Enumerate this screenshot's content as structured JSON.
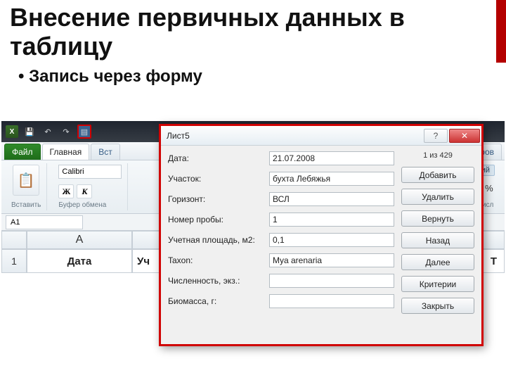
{
  "slide": {
    "title": "Внесение первичных данных в таблицу",
    "bullet": "Запись через форму"
  },
  "qat": {
    "app": "X",
    "save": "💾",
    "undo": "↶",
    "redo": "↷",
    "form": "▤"
  },
  "tabs": {
    "file": "Файл",
    "home": "Главная",
    "insert": "Вст",
    "review": "ензиров"
  },
  "ribbon": {
    "paste_label": "Вставить",
    "clipboard_group": "Буфер обмена",
    "font": "Calibri",
    "bold": "Ж",
    "italic": "К",
    "percent": "%",
    "number_group": "Числ",
    "cond_fmt": "ий"
  },
  "namebox": "A1",
  "grid": {
    "colA": "A",
    "colTlast": "Т",
    "row1": "1",
    "h_date": "Дата",
    "h_u": "Уч"
  },
  "dialog": {
    "title": "Лист5",
    "counter": "1 из 429",
    "labels": {
      "date": "Дата:",
      "site": "Участок:",
      "horizon": "Горизонт:",
      "sample": "Номер пробы:",
      "area": "Учетная площадь, м2:",
      "taxon": "Taxon:",
      "count": "Численность, экз.:",
      "biomass": "Биомасса, г:"
    },
    "values": {
      "date": "21.07.2008",
      "site": "бухта Лебяжья",
      "horizon": "ВСЛ",
      "sample": "1",
      "area": "0,1",
      "taxon": "Mya arenaria",
      "count": "",
      "biomass": ""
    },
    "buttons": {
      "add": "Добавить",
      "delete": "Удалить",
      "restore": "Вернуть",
      "prev": "Назад",
      "next": "Далее",
      "criteria": "Критерии",
      "close": "Закрыть"
    },
    "win": {
      "help": "?",
      "closeX": "✕"
    }
  }
}
